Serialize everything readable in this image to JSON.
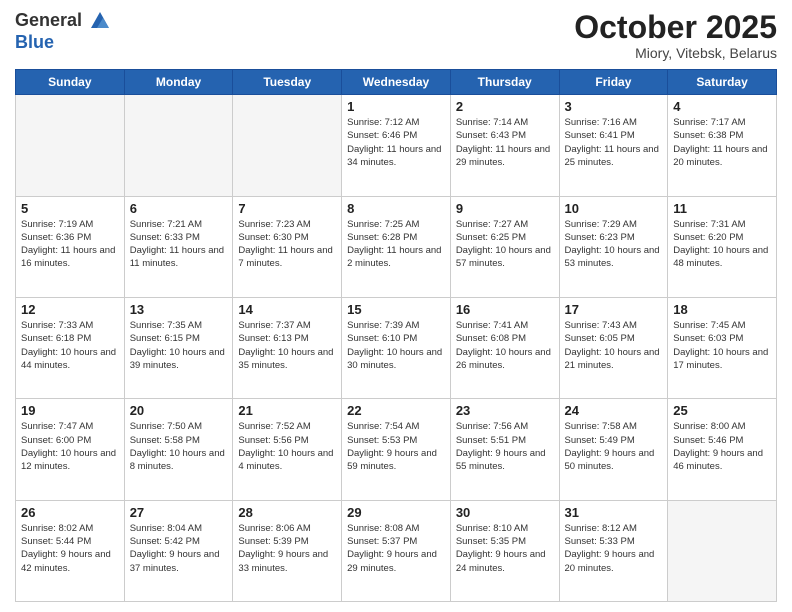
{
  "header": {
    "logo_line1": "General",
    "logo_line2": "Blue",
    "month": "October 2025",
    "location": "Miory, Vitebsk, Belarus"
  },
  "weekdays": [
    "Sunday",
    "Monday",
    "Tuesday",
    "Wednesday",
    "Thursday",
    "Friday",
    "Saturday"
  ],
  "weeks": [
    [
      {
        "day": "",
        "sunrise": "",
        "sunset": "",
        "daylight": ""
      },
      {
        "day": "",
        "sunrise": "",
        "sunset": "",
        "daylight": ""
      },
      {
        "day": "",
        "sunrise": "",
        "sunset": "",
        "daylight": ""
      },
      {
        "day": "1",
        "sunrise": "Sunrise: 7:12 AM",
        "sunset": "Sunset: 6:46 PM",
        "daylight": "Daylight: 11 hours and 34 minutes."
      },
      {
        "day": "2",
        "sunrise": "Sunrise: 7:14 AM",
        "sunset": "Sunset: 6:43 PM",
        "daylight": "Daylight: 11 hours and 29 minutes."
      },
      {
        "day": "3",
        "sunrise": "Sunrise: 7:16 AM",
        "sunset": "Sunset: 6:41 PM",
        "daylight": "Daylight: 11 hours and 25 minutes."
      },
      {
        "day": "4",
        "sunrise": "Sunrise: 7:17 AM",
        "sunset": "Sunset: 6:38 PM",
        "daylight": "Daylight: 11 hours and 20 minutes."
      }
    ],
    [
      {
        "day": "5",
        "sunrise": "Sunrise: 7:19 AM",
        "sunset": "Sunset: 6:36 PM",
        "daylight": "Daylight: 11 hours and 16 minutes."
      },
      {
        "day": "6",
        "sunrise": "Sunrise: 7:21 AM",
        "sunset": "Sunset: 6:33 PM",
        "daylight": "Daylight: 11 hours and 11 minutes."
      },
      {
        "day": "7",
        "sunrise": "Sunrise: 7:23 AM",
        "sunset": "Sunset: 6:30 PM",
        "daylight": "Daylight: 11 hours and 7 minutes."
      },
      {
        "day": "8",
        "sunrise": "Sunrise: 7:25 AM",
        "sunset": "Sunset: 6:28 PM",
        "daylight": "Daylight: 11 hours and 2 minutes."
      },
      {
        "day": "9",
        "sunrise": "Sunrise: 7:27 AM",
        "sunset": "Sunset: 6:25 PM",
        "daylight": "Daylight: 10 hours and 57 minutes."
      },
      {
        "day": "10",
        "sunrise": "Sunrise: 7:29 AM",
        "sunset": "Sunset: 6:23 PM",
        "daylight": "Daylight: 10 hours and 53 minutes."
      },
      {
        "day": "11",
        "sunrise": "Sunrise: 7:31 AM",
        "sunset": "Sunset: 6:20 PM",
        "daylight": "Daylight: 10 hours and 48 minutes."
      }
    ],
    [
      {
        "day": "12",
        "sunrise": "Sunrise: 7:33 AM",
        "sunset": "Sunset: 6:18 PM",
        "daylight": "Daylight: 10 hours and 44 minutes."
      },
      {
        "day": "13",
        "sunrise": "Sunrise: 7:35 AM",
        "sunset": "Sunset: 6:15 PM",
        "daylight": "Daylight: 10 hours and 39 minutes."
      },
      {
        "day": "14",
        "sunrise": "Sunrise: 7:37 AM",
        "sunset": "Sunset: 6:13 PM",
        "daylight": "Daylight: 10 hours and 35 minutes."
      },
      {
        "day": "15",
        "sunrise": "Sunrise: 7:39 AM",
        "sunset": "Sunset: 6:10 PM",
        "daylight": "Daylight: 10 hours and 30 minutes."
      },
      {
        "day": "16",
        "sunrise": "Sunrise: 7:41 AM",
        "sunset": "Sunset: 6:08 PM",
        "daylight": "Daylight: 10 hours and 26 minutes."
      },
      {
        "day": "17",
        "sunrise": "Sunrise: 7:43 AM",
        "sunset": "Sunset: 6:05 PM",
        "daylight": "Daylight: 10 hours and 21 minutes."
      },
      {
        "day": "18",
        "sunrise": "Sunrise: 7:45 AM",
        "sunset": "Sunset: 6:03 PM",
        "daylight": "Daylight: 10 hours and 17 minutes."
      }
    ],
    [
      {
        "day": "19",
        "sunrise": "Sunrise: 7:47 AM",
        "sunset": "Sunset: 6:00 PM",
        "daylight": "Daylight: 10 hours and 12 minutes."
      },
      {
        "day": "20",
        "sunrise": "Sunrise: 7:50 AM",
        "sunset": "Sunset: 5:58 PM",
        "daylight": "Daylight: 10 hours and 8 minutes."
      },
      {
        "day": "21",
        "sunrise": "Sunrise: 7:52 AM",
        "sunset": "Sunset: 5:56 PM",
        "daylight": "Daylight: 10 hours and 4 minutes."
      },
      {
        "day": "22",
        "sunrise": "Sunrise: 7:54 AM",
        "sunset": "Sunset: 5:53 PM",
        "daylight": "Daylight: 9 hours and 59 minutes."
      },
      {
        "day": "23",
        "sunrise": "Sunrise: 7:56 AM",
        "sunset": "Sunset: 5:51 PM",
        "daylight": "Daylight: 9 hours and 55 minutes."
      },
      {
        "day": "24",
        "sunrise": "Sunrise: 7:58 AM",
        "sunset": "Sunset: 5:49 PM",
        "daylight": "Daylight: 9 hours and 50 minutes."
      },
      {
        "day": "25",
        "sunrise": "Sunrise: 8:00 AM",
        "sunset": "Sunset: 5:46 PM",
        "daylight": "Daylight: 9 hours and 46 minutes."
      }
    ],
    [
      {
        "day": "26",
        "sunrise": "Sunrise: 8:02 AM",
        "sunset": "Sunset: 5:44 PM",
        "daylight": "Daylight: 9 hours and 42 minutes."
      },
      {
        "day": "27",
        "sunrise": "Sunrise: 8:04 AM",
        "sunset": "Sunset: 5:42 PM",
        "daylight": "Daylight: 9 hours and 37 minutes."
      },
      {
        "day": "28",
        "sunrise": "Sunrise: 8:06 AM",
        "sunset": "Sunset: 5:39 PM",
        "daylight": "Daylight: 9 hours and 33 minutes."
      },
      {
        "day": "29",
        "sunrise": "Sunrise: 8:08 AM",
        "sunset": "Sunset: 5:37 PM",
        "daylight": "Daylight: 9 hours and 29 minutes."
      },
      {
        "day": "30",
        "sunrise": "Sunrise: 8:10 AM",
        "sunset": "Sunset: 5:35 PM",
        "daylight": "Daylight: 9 hours and 24 minutes."
      },
      {
        "day": "31",
        "sunrise": "Sunrise: 8:12 AM",
        "sunset": "Sunset: 5:33 PM",
        "daylight": "Daylight: 9 hours and 20 minutes."
      },
      {
        "day": "",
        "sunrise": "",
        "sunset": "",
        "daylight": ""
      }
    ]
  ]
}
